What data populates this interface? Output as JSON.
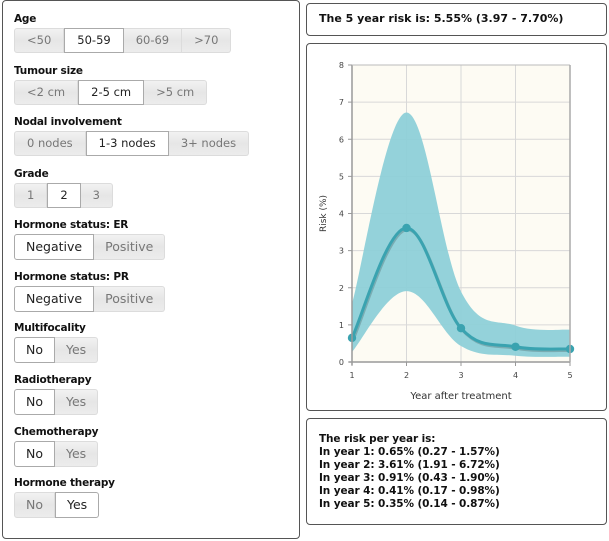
{
  "inputs": {
    "age": {
      "label": "Age",
      "options": [
        "<50",
        "50-59",
        "60-69",
        ">70"
      ],
      "selected": "50-59"
    },
    "tumour_size": {
      "label": "Tumour size",
      "options": [
        "<2 cm",
        "2-5 cm",
        ">5 cm"
      ],
      "selected": "2-5 cm"
    },
    "nodal": {
      "label": "Nodal involvement",
      "options": [
        "0 nodes",
        "1-3 nodes",
        "3+ nodes"
      ],
      "selected": "1-3 nodes"
    },
    "grade": {
      "label": "Grade",
      "options": [
        "1",
        "2",
        "3"
      ],
      "selected": "2"
    },
    "er": {
      "label": "Hormone status: ER",
      "options": [
        "Negative",
        "Positive"
      ],
      "selected": "Negative"
    },
    "pr": {
      "label": "Hormone status: PR",
      "options": [
        "Negative",
        "Positive"
      ],
      "selected": "Negative"
    },
    "multifocality": {
      "label": "Multifocality",
      "options": [
        "No",
        "Yes"
      ],
      "selected": "No"
    },
    "radiotherapy": {
      "label": "Radiotherapy",
      "options": [
        "No",
        "Yes"
      ],
      "selected": "No"
    },
    "chemotherapy": {
      "label": "Chemotherapy",
      "options": [
        "No",
        "Yes"
      ],
      "selected": "No"
    },
    "hormone_therapy": {
      "label": "Hormone therapy",
      "options": [
        "No",
        "Yes"
      ],
      "selected": "Yes"
    }
  },
  "summary": {
    "text": "The 5 year risk is: 5.55% (3.97 - 7.70%)"
  },
  "per_year": {
    "title": "The risk per year is:",
    "lines": [
      "In year 1: 0.65% (0.27 - 1.57%)",
      "In year 2: 3.61% (1.91 - 6.72%)",
      "In year 3: 0.91% (0.43 - 1.90%)",
      "In year 4: 0.41% (0.17 - 0.98%)",
      "In year 5: 0.35% (0.14 - 0.87%)"
    ]
  },
  "colors": {
    "band": "#8ed0d8",
    "line": "#3aa3b0",
    "plot_bg": "#fdfbf3",
    "grid": "#d8d8d8"
  },
  "chart_data": {
    "type": "line",
    "title": "",
    "xlabel": "Year after treatment",
    "ylabel": "Risk (%)",
    "x": [
      1,
      2,
      3,
      4,
      5
    ],
    "xticks": [
      "1",
      "2",
      "3",
      "4",
      "5"
    ],
    "yticks": [
      "0",
      "1",
      "2",
      "3",
      "4",
      "5",
      "6",
      "7",
      "8"
    ],
    "xlim": [
      1,
      5
    ],
    "ylim": [
      0,
      8
    ],
    "grid": true,
    "series": [
      {
        "name": "Risk",
        "values": [
          0.65,
          3.61,
          0.91,
          0.41,
          0.35
        ]
      },
      {
        "name": "Lower bound",
        "values": [
          0.27,
          1.91,
          0.43,
          0.17,
          0.14
        ]
      },
      {
        "name": "Upper bound",
        "values": [
          1.57,
          6.72,
          1.9,
          0.98,
          0.87
        ]
      }
    ]
  }
}
